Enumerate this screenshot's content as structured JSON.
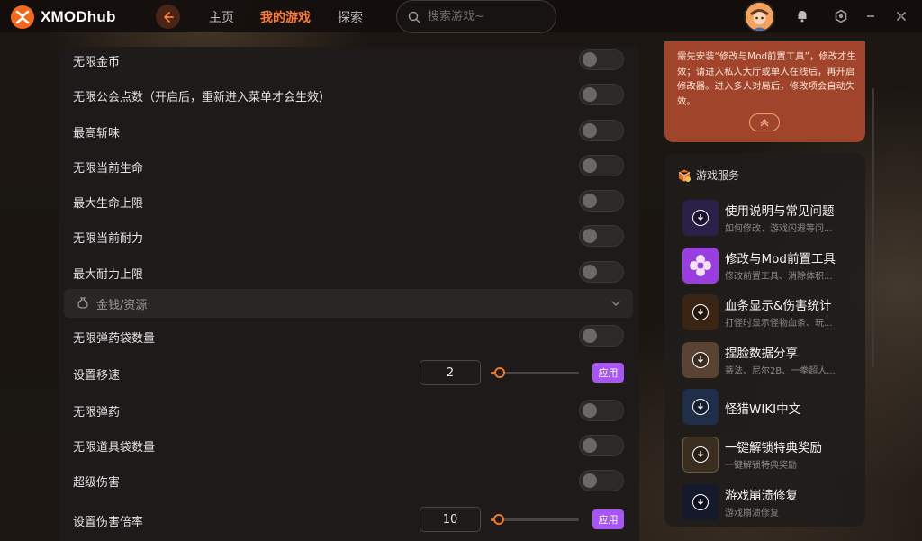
{
  "app": {
    "name": "XMODhub"
  },
  "nav": {
    "items": [
      {
        "label": "主页",
        "active": false
      },
      {
        "label": "我的游戏",
        "active": true
      },
      {
        "label": "探索",
        "active": false
      }
    ]
  },
  "search": {
    "placeholder": "搜索游戏~",
    "value": ""
  },
  "colors": {
    "accent": "#ff7a2e",
    "apply": "#a855f7",
    "notice_bg": "#a0452b"
  },
  "settings": {
    "rows_top": [
      {
        "label": "无限金币",
        "type": "toggle",
        "on": false
      },
      {
        "label": "无限公会点数（开启后，重新进入菜单才会生效）",
        "type": "toggle",
        "on": false
      },
      {
        "label": "最高斩味",
        "type": "toggle",
        "on": false
      },
      {
        "label": "无限当前生命",
        "type": "toggle",
        "on": false
      },
      {
        "label": "最大生命上限",
        "type": "toggle",
        "on": false
      },
      {
        "label": "无限当前耐力",
        "type": "toggle",
        "on": false
      },
      {
        "label": "最大耐力上限",
        "type": "toggle",
        "on": false
      }
    ],
    "section": {
      "label": "金钱/资源",
      "icon": "money-bag-icon",
      "expanded": true
    },
    "rows_bottom": [
      {
        "label": "无限弹药袋数量",
        "type": "toggle",
        "on": false
      },
      {
        "label": "设置移速",
        "type": "slider",
        "value": "2",
        "fill": 0.06,
        "apply_label": "应用"
      },
      {
        "label": "无限弹药",
        "type": "toggle",
        "on": false
      },
      {
        "label": "无限道具袋数量",
        "type": "toggle",
        "on": false
      },
      {
        "label": "超级伤害",
        "type": "toggle",
        "on": false
      },
      {
        "label": "设置伤害倍率",
        "type": "slider",
        "value": "10",
        "fill": 0.05,
        "apply_label": "应用"
      }
    ]
  },
  "notice": {
    "text": "需先安装“修改与Mod前置工具”，修改才生效；请进入私人大厅或单人在线后，再开启修改器。进入多人对局后，修改项会自动失效。",
    "collapse_icon": "chevron-up-icon"
  },
  "services": {
    "title": "游戏服务",
    "items": [
      {
        "title": "使用说明与常见问题",
        "subtitle": "如何修改、游戏闪退等问...",
        "icon": "download-icon",
        "thumb": "#2b2048"
      },
      {
        "title": "修改与Mod前置工具",
        "subtitle": "修改前置工具、消除体积...",
        "icon": "gear-flower-icon",
        "thumb": "#9a3ee0"
      },
      {
        "title": "血条显示&伤害统计",
        "subtitle": "打怪时显示怪物血条、玩...",
        "icon": "download-icon",
        "thumb": "#3a2414"
      },
      {
        "title": "捏脸数据分享",
        "subtitle": "蒂法、尼尔2B、一拳超人...",
        "icon": "download-icon",
        "thumb": "#5a4332"
      },
      {
        "title": "怪猎WIKI中文",
        "subtitle": "",
        "icon": "download-icon",
        "thumb": "#1f2f4a"
      },
      {
        "title": "一键解锁特典奖励",
        "subtitle": "一键解锁特典奖励",
        "icon": "download-icon",
        "thumb": "#3a2e20"
      },
      {
        "title": "游戏崩溃修复",
        "subtitle": "游戏崩溃修复",
        "icon": "download-icon",
        "thumb": "#141a2c"
      }
    ]
  }
}
